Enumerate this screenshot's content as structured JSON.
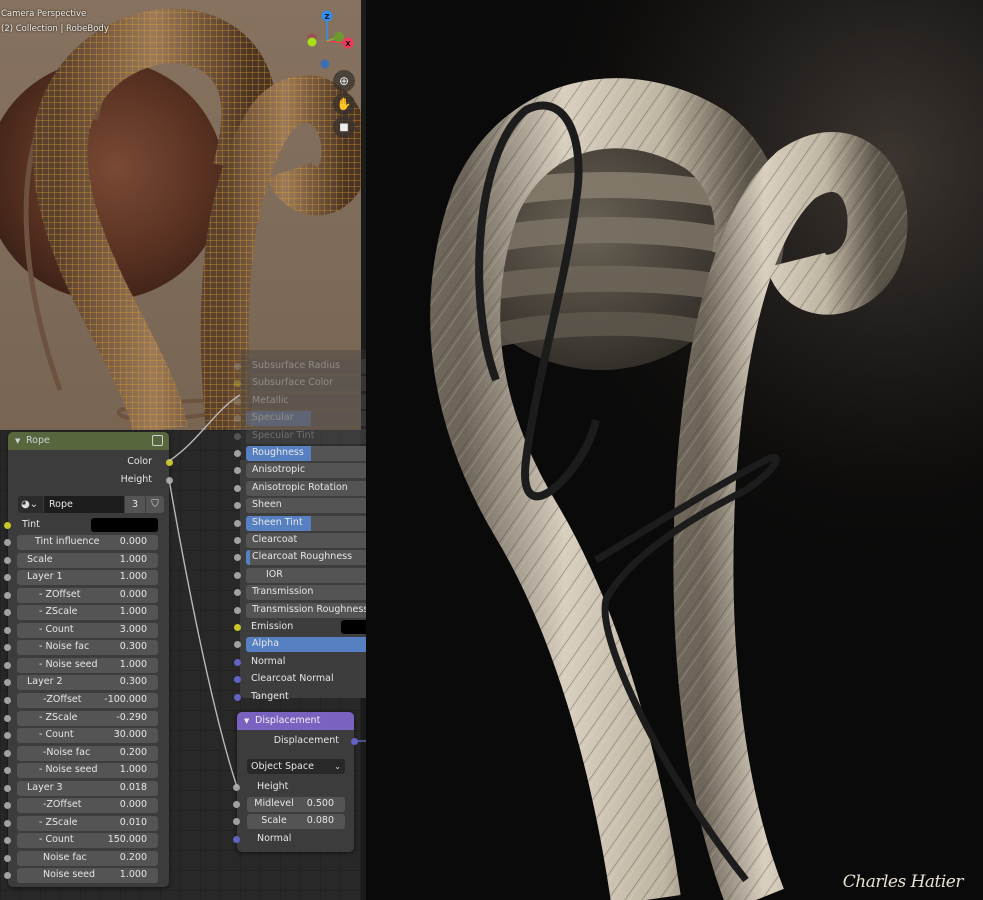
{
  "viewport": {
    "view_name": "Camera Perspective",
    "collection_info": "(2) Collection | RobeBody",
    "gizmo": {
      "axes": [
        {
          "label": "Z",
          "color": "#2f8fef"
        },
        {
          "label": "Y",
          "color": "#7fb236"
        },
        {
          "label": "X",
          "color": "#f0385a"
        }
      ]
    },
    "nav_buttons": [
      {
        "name": "zoom",
        "icon": "magnifier-plus-icon",
        "glyph": "⊕"
      },
      {
        "name": "pan",
        "icon": "hand-icon",
        "glyph": "✋"
      },
      {
        "name": "camera",
        "icon": "camera-icon",
        "glyph": "🎥"
      }
    ],
    "wire_color": "#f0a020"
  },
  "principled_node": {
    "inputs": [
      {
        "label": "Subsurface Radius",
        "socket": "gray",
        "fill": 0,
        "faded": true
      },
      {
        "label": "Subsurface Color",
        "socket": "yellow",
        "fill": 0,
        "faded": true
      },
      {
        "label": "Metallic",
        "socket": "gray",
        "fill": 0,
        "faded": true
      },
      {
        "label": "Specular",
        "socket": "gray",
        "fill": 0.5,
        "faded": true
      },
      {
        "label": "Specular Tint",
        "socket": "gray",
        "fill": 0,
        "faded": true
      },
      {
        "label": "Roughness",
        "socket": "gray",
        "fill": 0.5
      },
      {
        "label": "Anisotropic",
        "socket": "gray",
        "fill": 0
      },
      {
        "label": "Anisotropic Rotation",
        "socket": "gray",
        "fill": 0
      },
      {
        "label": "Sheen",
        "socket": "gray",
        "fill": 0
      },
      {
        "label": "Sheen Tint",
        "socket": "gray",
        "fill": 0.5
      },
      {
        "label": "Clearcoat",
        "socket": "gray",
        "fill": 0
      },
      {
        "label": "Clearcoat Roughness",
        "socket": "gray",
        "fill": 0.03
      },
      {
        "label": "IOR",
        "socket": "gray",
        "fill": 0,
        "indent": true
      },
      {
        "label": "Transmission",
        "socket": "gray",
        "fill": 0
      },
      {
        "label": "Transmission Roughness",
        "socket": "gray",
        "fill": 0
      },
      {
        "label": "Emission",
        "socket": "yellow",
        "color_swatch": "#000000",
        "plain": true
      },
      {
        "label": "Alpha",
        "socket": "gray",
        "fill": 1.0
      },
      {
        "label": "Normal",
        "socket": "purple",
        "plain": true
      },
      {
        "label": "Clearcoat Normal",
        "socket": "purple",
        "plain": true
      },
      {
        "label": "Tangent",
        "socket": "purple",
        "plain": true
      }
    ]
  },
  "rope_node": {
    "title": "Rope",
    "header_color": "#5a6a3e",
    "outputs": [
      {
        "label": "Color",
        "socket": "yellow"
      },
      {
        "label": "Height",
        "socket": "gray"
      }
    ],
    "datablock": {
      "name": "Rope",
      "users": "3"
    },
    "tint": {
      "label": "Tint",
      "color": "#000000"
    },
    "inputs": [
      {
        "label": "Tint influence",
        "value": "0.000",
        "indent": "   "
      },
      {
        "label": "Scale",
        "value": "1.000",
        "indent": " "
      },
      {
        "label": "Layer 1",
        "value": "1.000",
        "indent": " "
      },
      {
        "label": "- ZOffset",
        "value": "0.000",
        "indent": "    "
      },
      {
        "label": "- ZScale",
        "value": "1.000",
        "indent": "    "
      },
      {
        "label": "- Count",
        "value": "3.000",
        "indent": "    "
      },
      {
        "label": "- Noise fac",
        "value": "0.300",
        "indent": "    "
      },
      {
        "label": "- Noise seed",
        "value": "1.000",
        "indent": "    "
      },
      {
        "label": "Layer 2",
        "value": "0.300",
        "indent": " "
      },
      {
        "label": "-ZOffset",
        "value": "-100.000",
        "indent": "     "
      },
      {
        "label": "- ZScale",
        "value": "-0.290",
        "indent": "    "
      },
      {
        "label": "- Count",
        "value": "30.000",
        "indent": "    "
      },
      {
        "label": "-Noise fac",
        "value": "0.200",
        "indent": "     "
      },
      {
        "label": "- Noise seed",
        "value": "1.000",
        "indent": "    "
      },
      {
        "label": "Layer 3",
        "value": "0.018",
        "indent": " "
      },
      {
        "label": "-ZOffset",
        "value": "0.000",
        "indent": "     "
      },
      {
        "label": "- ZScale",
        "value": "0.010",
        "indent": "    "
      },
      {
        "label": "- Count",
        "value": "150.000",
        "indent": "    "
      },
      {
        "label": "Noise fac",
        "value": "0.200",
        "indent": "     "
      },
      {
        "label": "Noise seed",
        "value": "1.000",
        "indent": "     "
      }
    ]
  },
  "displacement_node": {
    "title": "Displacement",
    "header_color": "#7a63c0",
    "output_label": "Displacement",
    "space": "Object Space",
    "inputs": [
      {
        "label": "Height",
        "socket": "gray",
        "type": "plain"
      },
      {
        "label": "Midlevel",
        "value": "0.500",
        "socket": "gray",
        "type": "field"
      },
      {
        "label": "Scale",
        "value": "0.080",
        "socket": "gray",
        "type": "field"
      },
      {
        "label": "Normal",
        "socket": "purple",
        "type": "plain"
      }
    ]
  },
  "render": {
    "signature": "Charles Hatier",
    "rope_color": "#d8cfbf",
    "cord_color": "#1e1e1e"
  }
}
